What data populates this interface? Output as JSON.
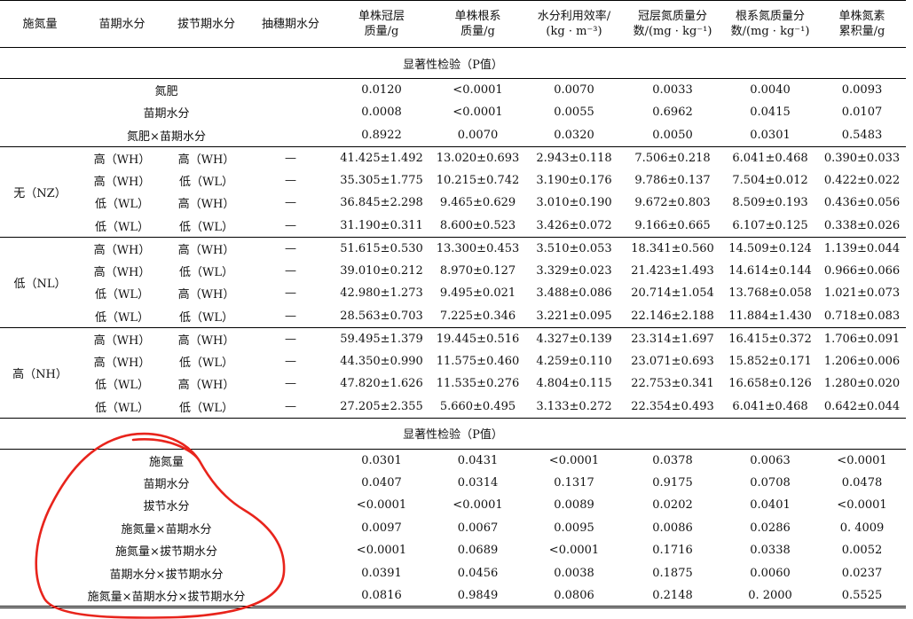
{
  "headers": [
    "施氮量",
    "苗期水分",
    "拔节期水分",
    "抽穗期水分",
    [
      "单株冠层",
      "质量/g"
    ],
    [
      "单株根系",
      "质量/g"
    ],
    [
      "水分利用效率/",
      "(kg · m⁻³)"
    ],
    [
      "冠层氮质量分",
      "数/(mg · kg⁻¹)"
    ],
    [
      "根系氮质量分",
      "数/(mg · kg⁻¹)"
    ],
    [
      "单株氮素",
      "累积量/g"
    ]
  ],
  "section1_title": "显著性检验（P值）",
  "section1_rows": [
    {
      "label": "氮肥",
      "values": [
        "0.0120",
        "<0.0001",
        "0.0070",
        "0.0033",
        "0.0040",
        "0.0093"
      ]
    },
    {
      "label": "苗期水分",
      "values": [
        "0.0008",
        "<0.0001",
        "0.0055",
        "0.6962",
        "0.0415",
        "0.0107"
      ]
    },
    {
      "label": "氮肥×苗期水分",
      "values": [
        "0.8922",
        "0.0070",
        "0.0320",
        "0.0050",
        "0.0301",
        "0.5483"
      ]
    }
  ],
  "groups": [
    {
      "label": "无（NZ）",
      "rows": [
        {
          "seedling": "高（WH）",
          "jointing": "高（WH）",
          "heading": "—",
          "values": [
            "41.425±1.492",
            "13.020±0.693",
            "2.943±0.118",
            "7.506±0.218",
            "6.041±0.468",
            "0.390±0.033"
          ]
        },
        {
          "seedling": "高（WH）",
          "jointing": "低（WL）",
          "heading": "—",
          "values": [
            "35.305±1.775",
            "10.215±0.742",
            "3.190±0.176",
            "9.786±0.137",
            "7.504±0.012",
            "0.422±0.022"
          ]
        },
        {
          "seedling": "低（WL）",
          "jointing": "高（WH）",
          "heading": "—",
          "values": [
            "36.845±2.298",
            "9.465±0.629",
            "3.010±0.190",
            "9.672±0.803",
            "8.509±0.193",
            "0.436±0.056"
          ]
        },
        {
          "seedling": "低（WL）",
          "jointing": "低（WL）",
          "heading": "—",
          "values": [
            "31.190±0.311",
            "8.600±0.523",
            "3.426±0.072",
            "9.166±0.665",
            "6.107±0.125",
            "0.338±0.026"
          ]
        }
      ]
    },
    {
      "label": "低（NL）",
      "rows": [
        {
          "seedling": "高（WH）",
          "jointing": "高（WH）",
          "heading": "—",
          "values": [
            "51.615±0.530",
            "13.300±0.453",
            "3.510±0.053",
            "18.341±0.560",
            "14.509±0.124",
            "1.139±0.044"
          ]
        },
        {
          "seedling": "高（WH）",
          "jointing": "低（WL）",
          "heading": "—",
          "values": [
            "39.010±0.212",
            "8.970±0.127",
            "3.329±0.023",
            "21.423±1.493",
            "14.614±0.144",
            "0.966±0.066"
          ]
        },
        {
          "seedling": "低（WL）",
          "jointing": "高（WH）",
          "heading": "—",
          "values": [
            "42.980±1.273",
            "9.495±0.021",
            "3.488±0.086",
            "20.714±1.054",
            "13.768±0.058",
            "1.021±0.073"
          ]
        },
        {
          "seedling": "低（WL）",
          "jointing": "低（WL）",
          "heading": "—",
          "values": [
            "28.563±0.703",
            "7.225±0.346",
            "3.221±0.095",
            "22.146±2.188",
            "11.884±1.430",
            "0.718±0.083"
          ]
        }
      ]
    },
    {
      "label": "高（NH）",
      "rows": [
        {
          "seedling": "高（WH）",
          "jointing": "高（WH）",
          "heading": "—",
          "values": [
            "59.495±1.379",
            "19.445±0.516",
            "4.327±0.139",
            "23.314±1.697",
            "16.415±0.372",
            "1.706±0.091"
          ]
        },
        {
          "seedling": "高（WH）",
          "jointing": "低（WL）",
          "heading": "—",
          "values": [
            "44.350±0.990",
            "11.575±0.460",
            "4.259±0.110",
            "23.071±0.693",
            "15.852±0.171",
            "1.206±0.006"
          ]
        },
        {
          "seedling": "低（WL）",
          "jointing": "高（WH）",
          "heading": "—",
          "values": [
            "47.820±1.626",
            "11.535±0.276",
            "4.804±0.115",
            "22.753±0.341",
            "16.658±0.126",
            "1.280±0.020"
          ]
        },
        {
          "seedling": "低（WL）",
          "jointing": "低（WL）",
          "heading": "—",
          "values": [
            "27.205±2.355",
            "5.660±0.495",
            "3.133±0.272",
            "22.354±0.493",
            "6.041±0.468",
            "0.642±0.044"
          ]
        }
      ]
    }
  ],
  "section2_title": "显著性检验（P值）",
  "section2_rows": [
    {
      "label": "施氮量",
      "values": [
        "0.0301",
        "0.0431",
        "<0.0001",
        "0.0378",
        "0.0063",
        "<0.0001"
      ]
    },
    {
      "label": "苗期水分",
      "values": [
        "0.0407",
        "0.0314",
        "0.1317",
        "0.9175",
        "0.0708",
        "0.0478"
      ]
    },
    {
      "label": "拔节水分",
      "values": [
        "<0.0001",
        "<0.0001",
        "0.0089",
        "0.0202",
        "0.0401",
        "<0.0001"
      ]
    },
    {
      "label": "施氮量×苗期水分",
      "values": [
        "0.0097",
        "0.0067",
        "0.0095",
        "0.0086",
        "0.0286",
        "0. 4009"
      ]
    },
    {
      "label": "施氮量×拔节期水分",
      "values": [
        "<0.0001",
        "0.0689",
        "<0.0001",
        "0.1716",
        "0.0338",
        "0.0052"
      ]
    },
    {
      "label": "苗期水分×拔节期水分",
      "values": [
        "0.0391",
        "0.0456",
        "0.0038",
        "0.1875",
        "0.0060",
        "0.0237"
      ]
    },
    {
      "label": "施氮量×苗期水分×拔节期水分",
      "values": [
        "0.0816",
        "0.9849",
        "0.0806",
        "0.2148",
        "0. 2000",
        "0.5525"
      ]
    }
  ],
  "annotation_color": "#e8241c"
}
